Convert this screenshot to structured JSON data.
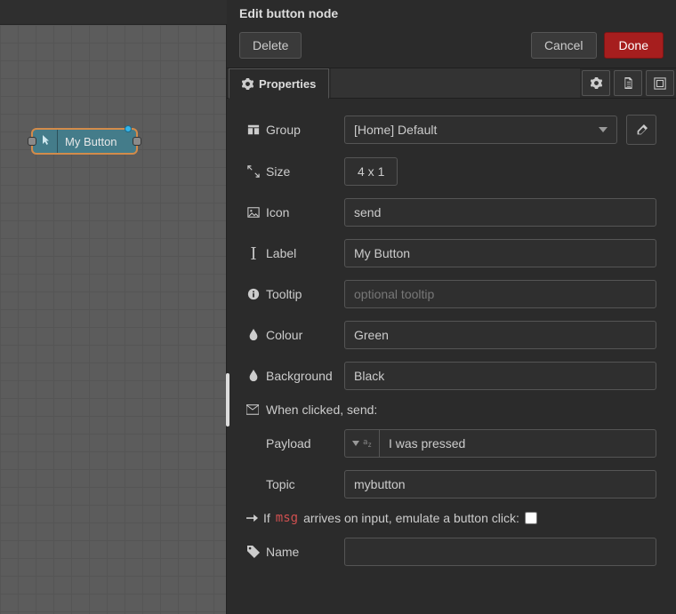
{
  "canvas": {
    "node_label": "My Button"
  },
  "editor": {
    "title": "Edit button node",
    "buttons": {
      "delete": "Delete",
      "cancel": "Cancel",
      "done": "Done"
    },
    "tabs": {
      "properties": "Properties"
    },
    "fields": {
      "group": {
        "label": "Group",
        "value": "[Home] Default"
      },
      "size": {
        "label": "Size",
        "value": "4 x 1"
      },
      "icon": {
        "label": "Icon",
        "value": "send"
      },
      "label": {
        "label": "Label",
        "value": "My Button"
      },
      "tooltip": {
        "label": "Tooltip",
        "placeholder": "optional tooltip",
        "value": ""
      },
      "colour": {
        "label": "Colour",
        "value": "Green"
      },
      "background": {
        "label": "Background",
        "value": "Black"
      },
      "when_clicked": "When clicked, send:",
      "payload": {
        "label": "Payload",
        "value": "I was pressed"
      },
      "topic": {
        "label": "Topic",
        "value": "mybutton"
      },
      "emulate_prefix": "If",
      "emulate_code": "msg",
      "emulate_suffix": "arrives on input, emulate a button click:",
      "name": {
        "label": "Name",
        "value": ""
      }
    }
  }
}
